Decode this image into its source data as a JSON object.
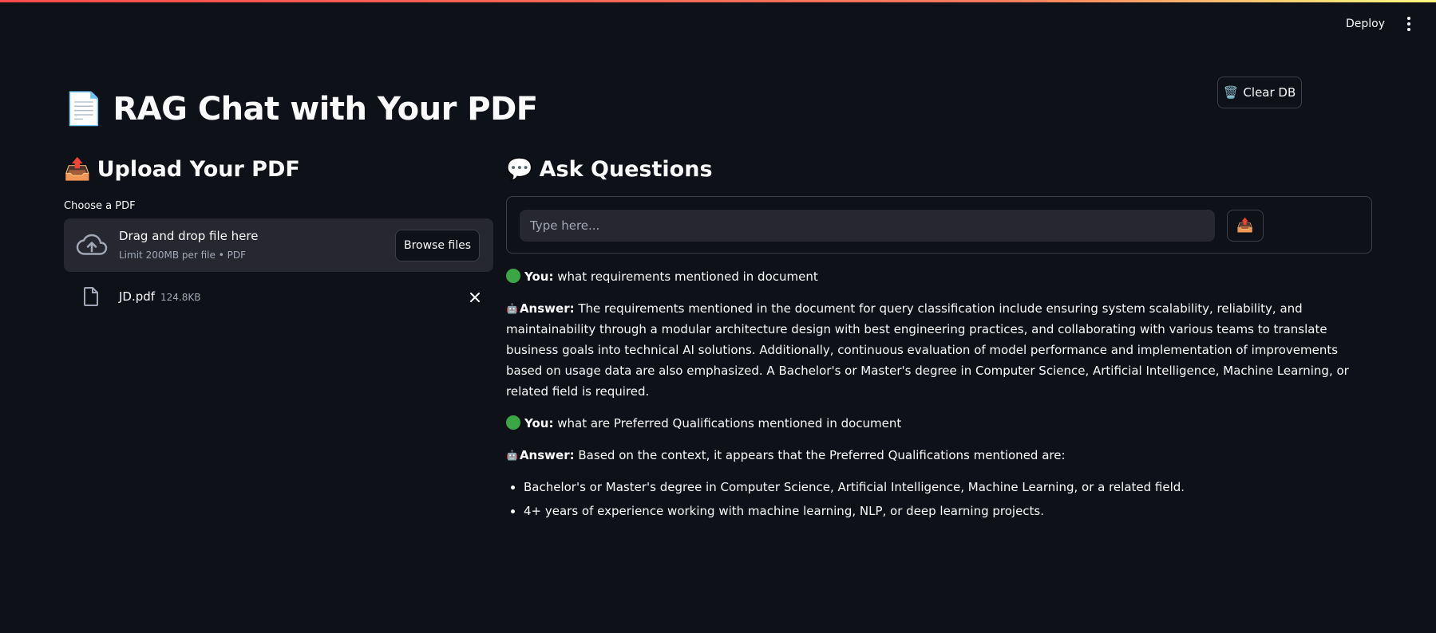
{
  "header": {
    "deploy_label": "Deploy"
  },
  "actions": {
    "clear_db_icon": "🗑️",
    "clear_db_label": "Clear DB"
  },
  "title": {
    "icon": "📄",
    "text": "RAG Chat with Your PDF"
  },
  "upload": {
    "icon": "📤",
    "heading": "Upload Your PDF",
    "choose_label": "Choose a PDF",
    "drop_text": "Drag and drop file here",
    "limit_text": "Limit 200MB per file • PDF",
    "browse_label": "Browse files",
    "file": {
      "name": "JD.pdf",
      "size": "124.8KB"
    }
  },
  "ask": {
    "icon": "💬",
    "heading": "Ask Questions",
    "placeholder": "Type here...",
    "send_icon": "📤"
  },
  "chat": {
    "user_prefix": "You:",
    "answer_prefix": "Answer:",
    "robot_icon": "🤖",
    "messages": [
      {
        "role": "user",
        "text": "what requirements mentioned in document"
      },
      {
        "role": "answer",
        "text": "The requirements mentioned in the document for query classification include ensuring system scalability, reliability, and maintainability through a modular architecture design with best engineering practices, and collaborating with various teams to translate business goals into technical AI solutions. Additionally, continuous evaluation of model performance and implementation of improvements based on usage data are also emphasized. A Bachelor's or Master's degree in Computer Science, Artificial Intelligence, Machine Learning, or related field is required."
      },
      {
        "role": "user",
        "text": "what are Preferred Qualifications mentioned in document"
      },
      {
        "role": "answer",
        "text": "Based on the context, it appears that the Preferred Qualifications mentioned are:"
      }
    ],
    "bullets": [
      "Bachelor's or Master's degree in Computer Science, Artificial Intelligence, Machine Learning, or a related field.",
      "4+ years of experience working with machine learning, NLP, or deep learning projects."
    ]
  },
  "colors": {
    "background": "#0e1117",
    "surface": "#262730",
    "border": "#3b3f4a",
    "text": "#fafafa",
    "muted": "#a3a8b8",
    "user_dot": "#3aa646"
  }
}
